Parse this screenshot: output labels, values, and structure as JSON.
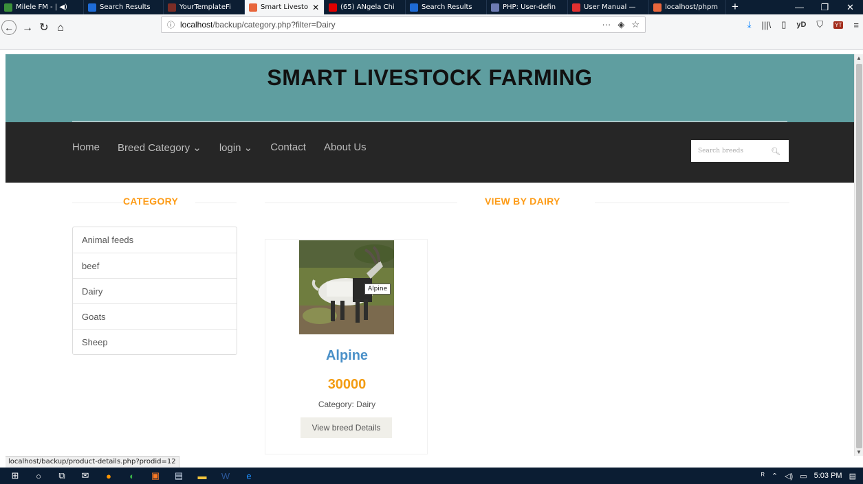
{
  "browser": {
    "tabs": [
      {
        "label": "Milele FM - | ◀)",
        "icon_color": "#3a8f3a"
      },
      {
        "label": "Search Results",
        "icon_color": "#1e6bd6"
      },
      {
        "label": "YourTemplateFi",
        "icon_color": "#7b2d26"
      },
      {
        "label": "Smart Livesto",
        "icon_color": "#e8663c",
        "active": true
      },
      {
        "label": "(65) ANgela Chi",
        "icon_color": "#e00000"
      },
      {
        "label": "Search Results",
        "icon_color": "#1e6bd6"
      },
      {
        "label": "PHP: User-defin",
        "icon_color": "#6d7bb3"
      },
      {
        "label": "User Manual —",
        "icon_color": "#e03030"
      },
      {
        "label": "localhost/phpm",
        "icon_color": "#e8663c"
      }
    ],
    "url_host": "localhost",
    "url_path": "/backup/category.php?filter=Dairy",
    "status_text": "localhost/backup/product-details.php?prodid=12"
  },
  "site": {
    "title": "SMART LIVESTOCK FARMING",
    "menu": {
      "home": "Home",
      "breed_category": "Breed Category ⌄",
      "login": "login ⌄",
      "contact": "Contact",
      "about": "About Us"
    },
    "search_placeholder": "Search breeds"
  },
  "sidebar": {
    "heading": "CATEGORY",
    "items": [
      "Animal feeds",
      "beef",
      "Dairy",
      "Goats",
      "Sheep"
    ]
  },
  "main": {
    "heading": "VIEW BY DAIRY",
    "product": {
      "tooltip": "Alpine",
      "name": "Alpine",
      "price": "30000",
      "category": "Category: Dairy",
      "button": "View breed Details"
    }
  },
  "system": {
    "time": "5:03 PM"
  },
  "colors": {
    "header_bg": "#5f9ea0",
    "menubar_bg": "#262626",
    "heading_orange": "#fd9b16",
    "product_name_blue": "#4a90c8",
    "price_orange": "#f39c12"
  }
}
